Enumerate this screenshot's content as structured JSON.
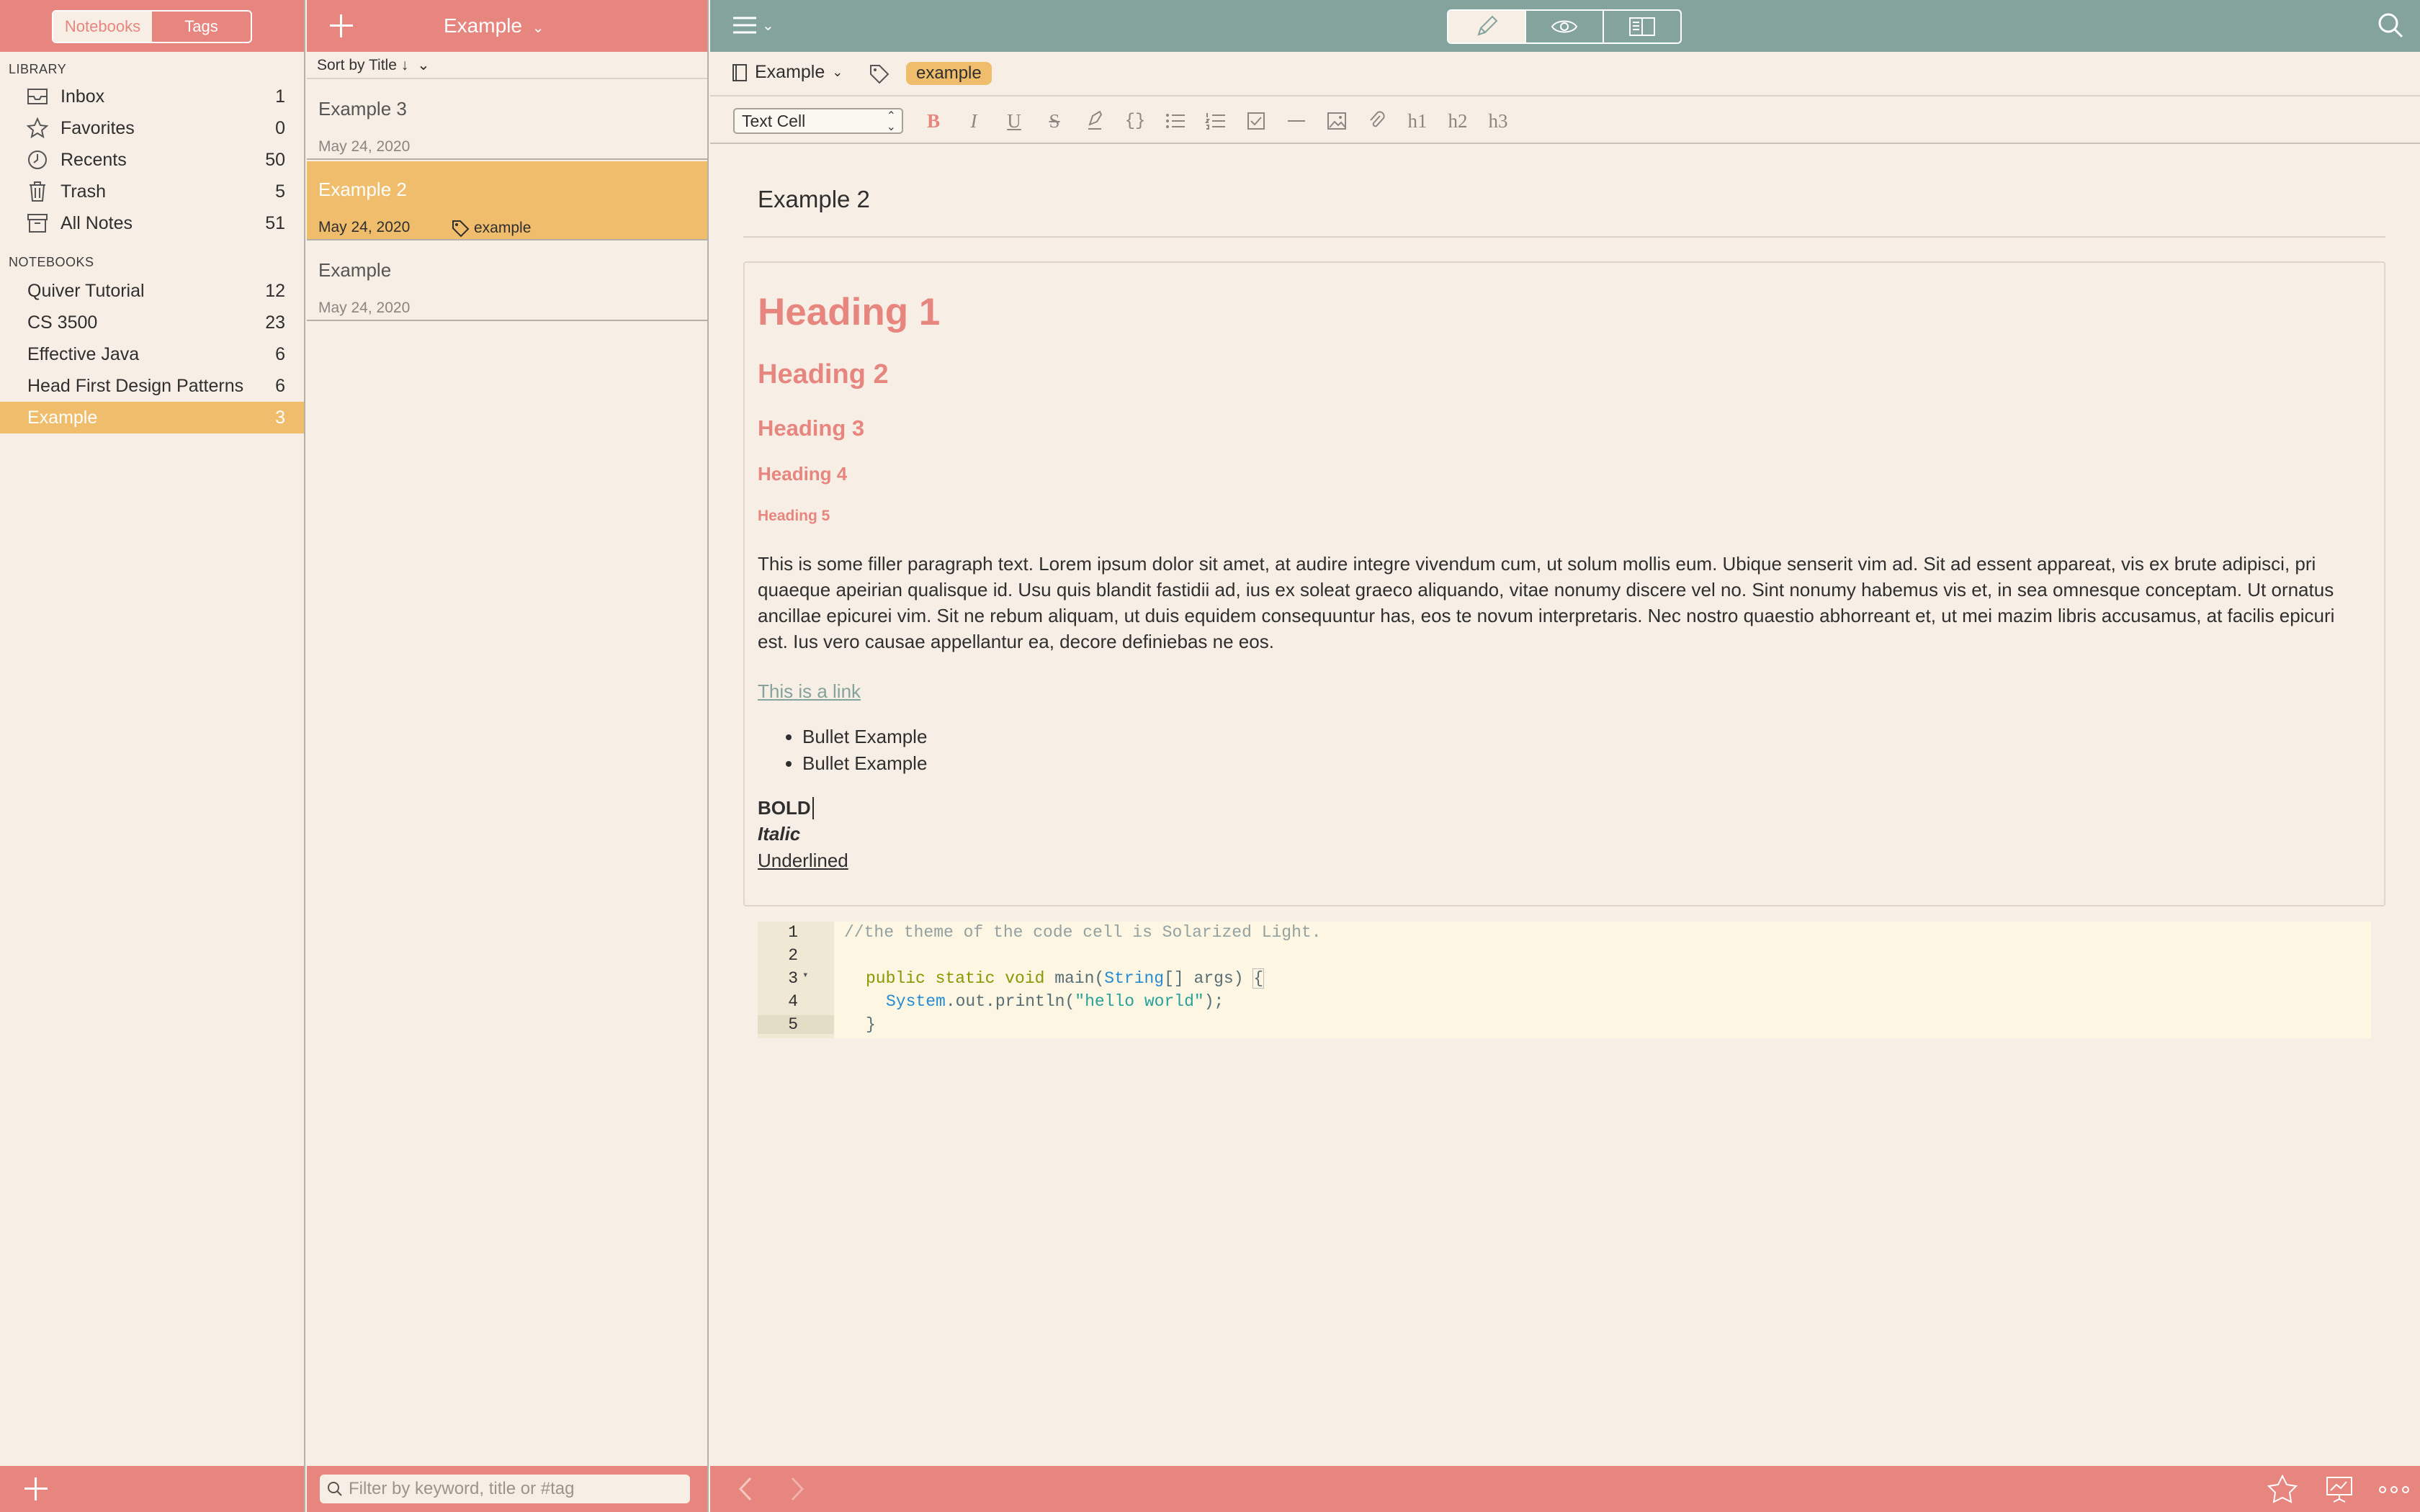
{
  "sidebar": {
    "tabs": [
      "Notebooks",
      "Tags"
    ],
    "library_label": "LIBRARY",
    "library": [
      {
        "label": "Inbox",
        "count": "1",
        "icon": "inbox-icon"
      },
      {
        "label": "Favorites",
        "count": "0",
        "icon": "star-icon"
      },
      {
        "label": "Recents",
        "count": "50",
        "icon": "clock-icon"
      },
      {
        "label": "Trash",
        "count": "5",
        "icon": "trash-icon"
      },
      {
        "label": "All Notes",
        "count": "51",
        "icon": "archive-icon"
      }
    ],
    "notebooks_label": "NOTEBOOKS",
    "notebooks": [
      {
        "label": "Quiver Tutorial",
        "count": "12"
      },
      {
        "label": "CS 3500",
        "count": "23"
      },
      {
        "label": "Effective Java",
        "count": "6"
      },
      {
        "label": "Head First Design Patterns",
        "count": "6"
      },
      {
        "label": "Example",
        "count": "3"
      }
    ]
  },
  "notelist": {
    "title": "Example",
    "sort": "Sort by Title ↓",
    "notes": [
      {
        "title": "Example 3",
        "date": "May 24, 2020"
      },
      {
        "title": "Example 2",
        "date": "May 24, 2020",
        "tag": "example"
      },
      {
        "title": "Example",
        "date": "May 24, 2020"
      }
    ],
    "filter_placeholder": "Filter by keyword, title or #tag"
  },
  "editor": {
    "notebook": "Example",
    "tag": "example",
    "cell_type": "Text Cell",
    "toolbar": [
      "B",
      "I",
      "U",
      "S",
      "highlight",
      "{}",
      "bullet-list",
      "number-list",
      "checklist",
      "hr",
      "image",
      "attach",
      "h1",
      "h2",
      "h3"
    ],
    "note_title": "Example 2",
    "headings": [
      "Heading 1",
      "Heading 2",
      "Heading 3",
      "Heading 4",
      "Heading 5"
    ],
    "paragraph": "This is some filler paragraph text. Lorem ipsum dolor sit amet, at audire integre vivendum cum, ut solum mollis eum. Ubique senserit vim ad. Sit ad essent appareat, vis ex brute adipisci, pri quaeque apeirian qualisque id. Usu quis blandit fastidii ad, ius ex soleat graeco aliquando, vitae nonumy discere vel no. Sint nonumy habemus vis et, in sea omnesque conceptam. Ut ornatus ancillae epicurei vim. Sit ne rebum aliquam, ut duis equidem consequuntur has, eos te novum interpretaris. Nec nostro quaestio abhorreant et, ut mei mazim libris accusamus, at facilis epicuri est. Ius vero causae appellantur ea, decore definiebas ne eos.",
    "link": "This is a link",
    "bullets": [
      "Bullet Example",
      "Bullet Example"
    ],
    "bold": "BOLD",
    "italic": "Italic",
    "underlined": "Underlined",
    "code_lines": [
      "1",
      "2",
      "3",
      "4",
      "5"
    ],
    "code_comment": "//the theme of the code cell is Solarized Light.",
    "code_sig": "public static void main(String[] args) {",
    "code_body": "System.out.println(\"hello world\");",
    "code_close": "}"
  },
  "colors": {
    "accent": "#e7857f",
    "selection": "#efbd6c",
    "editor_bar": "#84a39c",
    "background": "#f7efe5"
  }
}
